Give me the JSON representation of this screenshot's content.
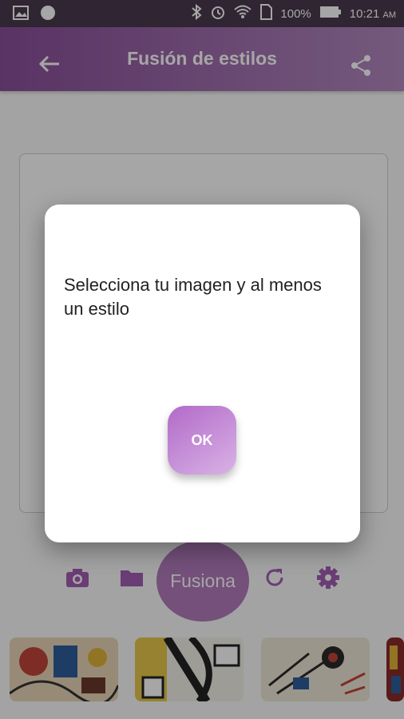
{
  "status_bar": {
    "battery": "100%",
    "time": "10:21",
    "ampm": "AM"
  },
  "app_bar": {
    "title": "Fusión de estilos"
  },
  "toolbar": {
    "fuse_label": "Fusiona"
  },
  "dialog": {
    "message": "Selecciona tu imagen y al menos un estilo",
    "ok_label": "OK"
  },
  "colors": {
    "accent": "#9b59b6",
    "appbar_start": "#8a4f9a",
    "appbar_end": "#b38ac0",
    "ok_button": "#c08bd3"
  },
  "icons": [
    "image-icon",
    "circle-icon",
    "bluetooth-icon",
    "alarm-icon",
    "wifi-icon",
    "sim-icon",
    "battery-icon",
    "back-arrow-icon",
    "share-icon",
    "camera-icon",
    "folder-icon",
    "refresh-icon",
    "settings-icon"
  ]
}
